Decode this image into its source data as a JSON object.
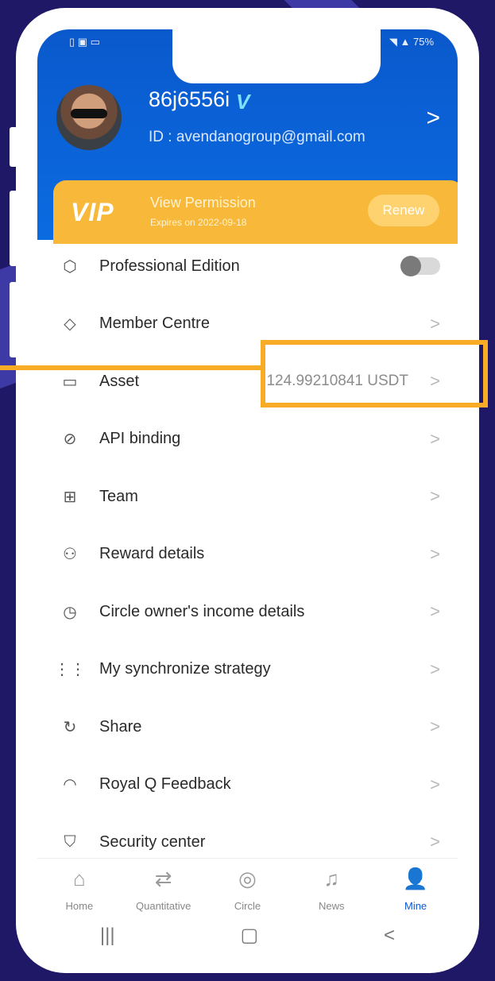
{
  "status": {
    "left": "▯ ▣ ▭",
    "right": "◥ ▲ 75%"
  },
  "header": {
    "username": "86j6556i",
    "badge": "V",
    "id_label": "ID : avendanogroup@gmail.com",
    "chevron": ">"
  },
  "vip": {
    "logo": "VIP",
    "title": "View Permission",
    "expiry": "Expires on 2022-09-18",
    "renew_label": "Renew"
  },
  "menu": {
    "items": [
      {
        "label": "Professional Edition",
        "icon": "⬡"
      },
      {
        "label": "Member Centre",
        "icon": "◇"
      },
      {
        "label": "Asset",
        "icon": "▭",
        "value": "124.99210841 USDT"
      },
      {
        "label": "API binding",
        "icon": "⊘"
      },
      {
        "label": "Team",
        "icon": "⊞"
      },
      {
        "label": "Reward details",
        "icon": "⚇"
      },
      {
        "label": "Circle owner's income details",
        "icon": "◷"
      },
      {
        "label": "My synchronize strategy",
        "icon": "⋮⋮"
      },
      {
        "label": "Share",
        "icon": "↻"
      },
      {
        "label": "Royal Q Feedback",
        "icon": "◠"
      },
      {
        "label": "Security center",
        "icon": "⛉"
      }
    ],
    "chevron": ">"
  },
  "bottom_nav": [
    {
      "label": "Home",
      "icon": "⌂"
    },
    {
      "label": "Quantitative",
      "icon": "⇄"
    },
    {
      "label": "Circle",
      "icon": "◎"
    },
    {
      "label": "News",
      "icon": "♫"
    },
    {
      "label": "Mine",
      "icon": "👤"
    }
  ],
  "system_nav": {
    "recent": "|||",
    "home": "▢",
    "back": "<"
  },
  "colors": {
    "primary": "#0b59d6",
    "vip": "#f8b83a",
    "highlight": "#f8ab24",
    "background": "#1f1866"
  }
}
